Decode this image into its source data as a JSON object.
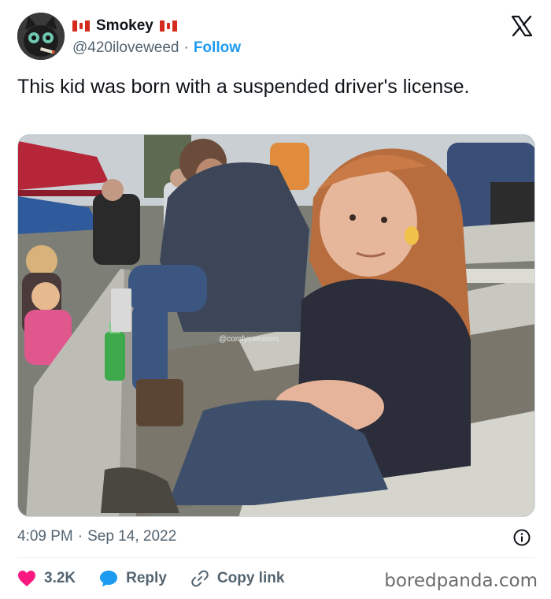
{
  "author": {
    "display_name": "Smokey",
    "handle": "@420iloveweed",
    "separator": "·",
    "follow_label": "Follow"
  },
  "tweet": {
    "text": "This kid was born with a suspended driver's license.",
    "image_watermark": "@comfysweaters",
    "time": "4:09 PM",
    "date": "Sep 14, 2022"
  },
  "actions": {
    "likes": "3.2K",
    "reply_label": "Reply",
    "copy_link_label": "Copy link"
  },
  "site_watermark": "boredpanda.com",
  "colors": {
    "link_blue": "#1d9bf0",
    "like_red": "#f91880",
    "text_primary": "#0f1419",
    "text_secondary": "#536471"
  },
  "icons": [
    "canada-flag-icon",
    "x-logo-icon",
    "info-icon",
    "heart-icon",
    "reply-bubble-icon",
    "link-icon"
  ]
}
